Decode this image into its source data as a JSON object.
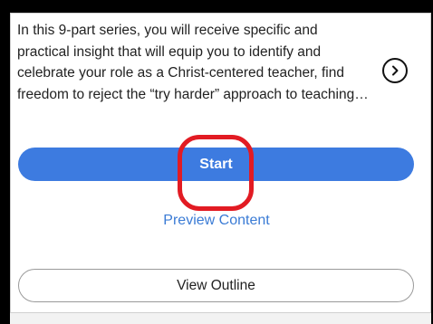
{
  "plan": {
    "description": "In this 9-part series, you will receive specific and practical insight that will equip you to identify and celebrate your role as a Christ-centered teacher, find freedom to reject the “try harder” approach to teaching and learn to rest in God’s grace."
  },
  "actions": {
    "start_label": "Start",
    "preview_label": "Preview Content",
    "outline_label": "View Outline",
    "next_icon": "chevron-right-icon"
  },
  "colors": {
    "primary": "#3d7be0",
    "link": "#3a7bd5",
    "annotation": "#e21b23"
  }
}
